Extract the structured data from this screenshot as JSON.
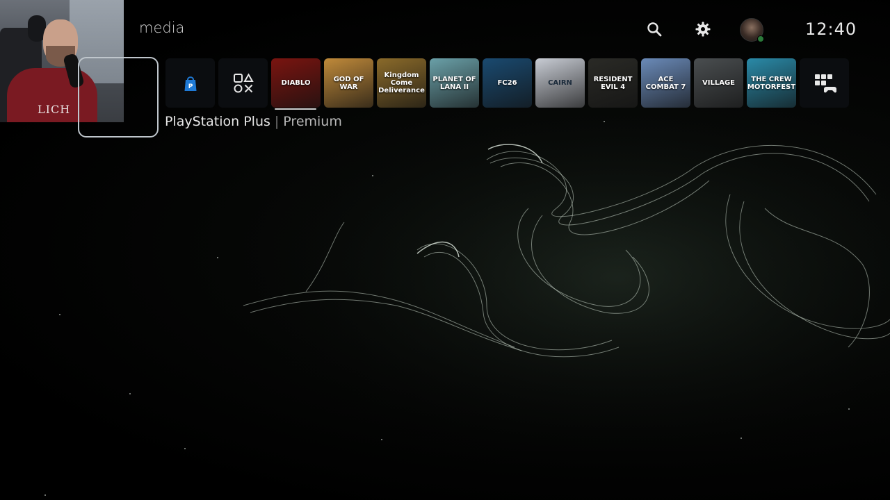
{
  "header": {
    "section_label": "media",
    "clock": "12:40",
    "icons": [
      "search-icon",
      "gear-icon",
      "avatar"
    ]
  },
  "tiles": [
    {
      "name": "PlayStation Store",
      "icon": "ps-store-icon",
      "text": ""
    },
    {
      "name": "Game Library",
      "icon": "game-library-icon",
      "text": ""
    },
    {
      "name": "Diablo II",
      "text": "DIABLO",
      "color": "#7a1410"
    },
    {
      "name": "God of War",
      "text": "GOD OF WAR",
      "color": "#c08a3a"
    },
    {
      "name": "Kingdom Come Deliverance",
      "text": "Kingdom Come Deliverance",
      "color": "#8a6a2a"
    },
    {
      "name": "Planet of Lana II",
      "text": "PLANET OF LANA II",
      "color": "#6aa0a8"
    },
    {
      "name": "EA Sports FC 26",
      "text": "FC26",
      "color": "#1a4a70"
    },
    {
      "name": "Cairn",
      "text": "CAIRN",
      "color": "#c8ccd4"
    },
    {
      "name": "Resident Evil 4",
      "text": "RESIDENT EVIL 4",
      "color": "#2a2a26"
    },
    {
      "name": "Ace Combat 7",
      "text": "ACE COMBAT 7",
      "color": "#6a8ab8"
    },
    {
      "name": "Resident Evil Village",
      "text": "VILLAGE",
      "color": "#4a4e50"
    },
    {
      "name": "The Crew Motorfest",
      "text": "THE CREW MOTORFEST",
      "color": "#2a8aa8"
    },
    {
      "name": "Game Base",
      "icon": "apps-icon",
      "text": ""
    }
  ],
  "selected": {
    "title": "PlayStation Plus",
    "subtitle": "Premium"
  },
  "webcam": {
    "shirt_text": "LICH"
  }
}
